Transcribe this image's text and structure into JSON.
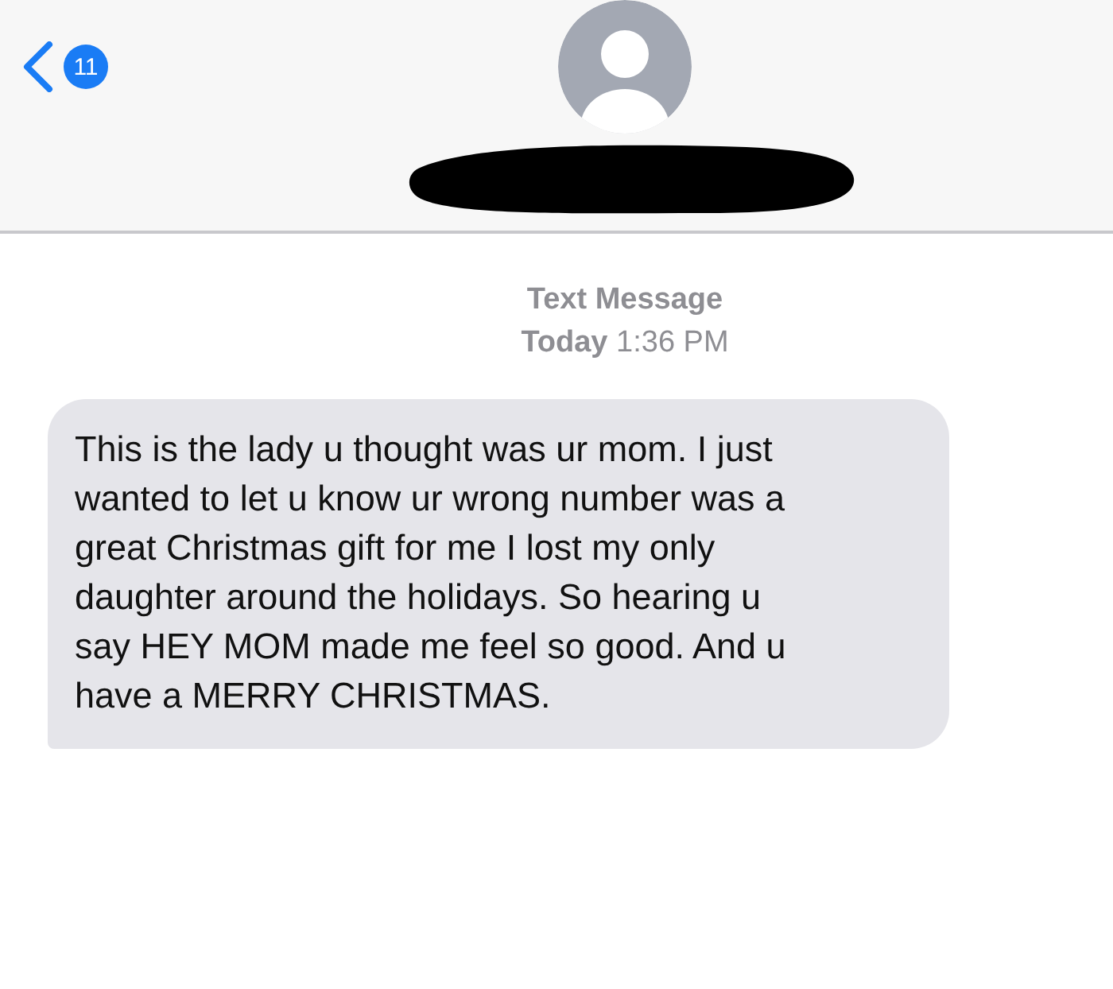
{
  "header": {
    "back_badge": "11"
  },
  "meta": {
    "service": "Text Message",
    "time": "**Today** 1:36 PM"
  },
  "messages": [
    {
      "text": "This is the lady u thought was ur mom. I just wanted to let u know ur wrong number was a great Christmas gift for me I lost my only daughter around the holidays. So hearing u say HEY MOM made me feel so good. And u have a MERRY CHRISTMAS."
    }
  ]
}
